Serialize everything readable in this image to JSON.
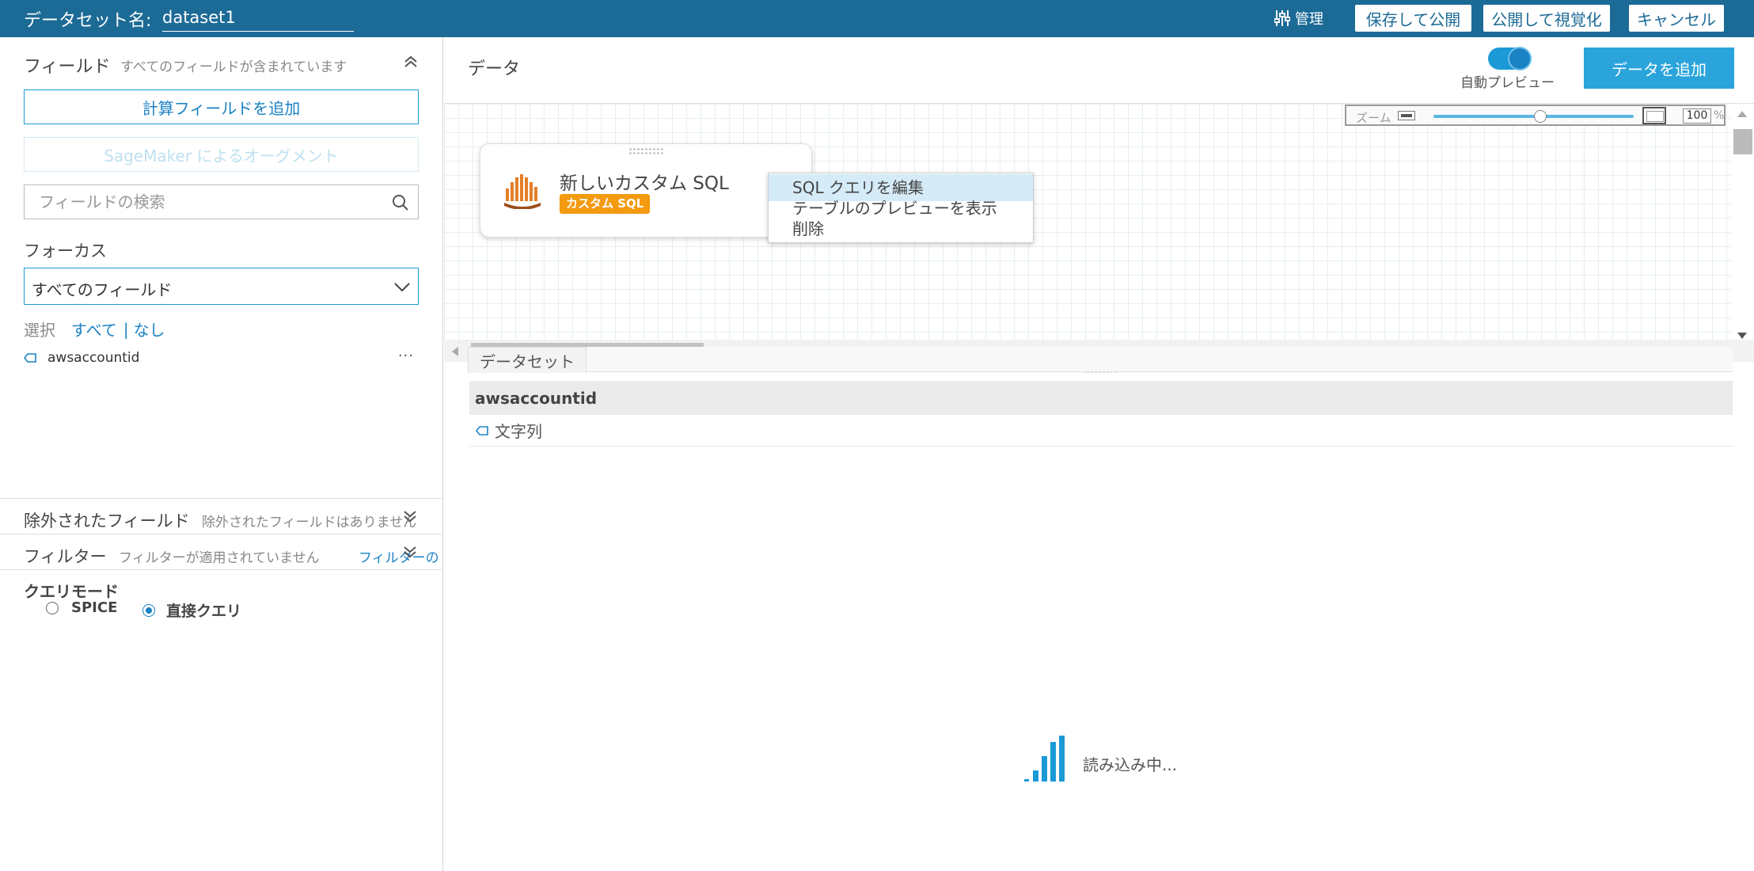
{
  "topbar": {
    "dataset_label": "データセット名:",
    "dataset_name": "dataset1",
    "manage_label": "管理",
    "save_publish": "保存して公開",
    "publish_visualize": "公開して視覚化",
    "cancel": "キャンセル"
  },
  "fields": {
    "title": "フィールド",
    "subtitle": "すべてのフィールドが含まれています",
    "add_calc_button": "計算フィールドを追加",
    "sagemaker_button": "SageMaker によるオーグメント",
    "search_placeholder": "フィールドの検索",
    "focus_label": "フォーカス",
    "focus_value": "すべてのフィールド",
    "select_label": "選択",
    "select_all": "すべて",
    "select_separator": "|",
    "select_none": "なし",
    "items": [
      {
        "name": "awsaccountid"
      }
    ],
    "more_glyph": "···"
  },
  "excluded": {
    "title": "除外されたフィールド",
    "subtitle": "除外されたフィールドはありません"
  },
  "filters": {
    "title": "フィルター",
    "subtitle": "フィルターが適用されていません",
    "link": "フィルターの"
  },
  "query_mode": {
    "title": "クエリモード",
    "options": [
      "SPICE",
      "直接クエリ"
    ],
    "selected": "直接クエリ"
  },
  "data": {
    "title": "データ",
    "auto_preview_label": "自動プレビュー",
    "auto_preview_on": true,
    "add_data_button": "データを追加"
  },
  "zoom": {
    "label": "ズーム",
    "value": "100",
    "unit": "%",
    "level_fraction": 0.95
  },
  "node": {
    "title": "新しいカスタム SQL",
    "badge": "カスタム SQL",
    "badge_color": "#f39a0e"
  },
  "context_menu": {
    "items": [
      "SQL クエリを編集",
      "テーブルのプレビューを表示",
      "削除"
    ],
    "active_index": 0
  },
  "preview": {
    "tab": "データセット",
    "columns": [
      {
        "name": "awsaccountid",
        "type": "文字列"
      }
    ],
    "loading_text": "読み込み中..."
  },
  "colors": {
    "topbar": "#1c6a96",
    "accent": "#1b9ad6",
    "primary_button": "#2ba4dc"
  }
}
